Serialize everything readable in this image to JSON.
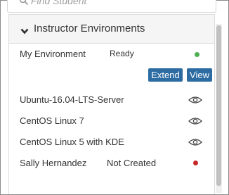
{
  "search": {
    "placeholder": "Find Student"
  },
  "panel": {
    "title": "Instructor Environments",
    "my_environment": {
      "name": "My Environment",
      "status": "Ready",
      "status_color": "#4caf50",
      "extend_label": "Extend",
      "view_label": "View"
    },
    "templates": [
      {
        "name": "Ubuntu-16.04-LTS-Server",
        "icon": "eye-icon"
      },
      {
        "name": "CentOS Linux 7",
        "icon": "eye-icon"
      },
      {
        "name": "CentOS Linux 5 with KDE",
        "icon": "eye-icon"
      }
    ],
    "students": [
      {
        "name": "Sally Hernandez",
        "status": "Not Created",
        "status_color": "#c62828"
      }
    ]
  },
  "colors": {
    "button": "#2d6ca2",
    "header_bg": "#f5f5f5"
  }
}
